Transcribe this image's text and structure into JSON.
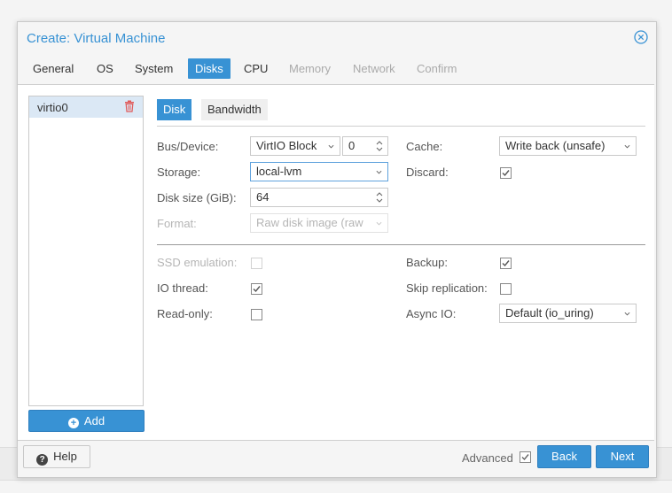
{
  "dialog": {
    "title": "Create: Virtual Machine"
  },
  "tabs": [
    {
      "label": "General",
      "state": "normal"
    },
    {
      "label": "OS",
      "state": "normal"
    },
    {
      "label": "System",
      "state": "normal"
    },
    {
      "label": "Disks",
      "state": "active"
    },
    {
      "label": "CPU",
      "state": "normal"
    },
    {
      "label": "Memory",
      "state": "disabled"
    },
    {
      "label": "Network",
      "state": "disabled"
    },
    {
      "label": "Confirm",
      "state": "disabled"
    }
  ],
  "disks": {
    "items": [
      {
        "label": "virtio0"
      }
    ],
    "add_label": "Add"
  },
  "subtabs": {
    "disk": "Disk",
    "bandwidth": "Bandwidth"
  },
  "form": {
    "bus_device": {
      "label": "Bus/Device:",
      "bus": "VirtIO Block",
      "index": "0"
    },
    "storage": {
      "label": "Storage:",
      "value": "local-lvm"
    },
    "disk_size": {
      "label": "Disk size (GiB):",
      "value": "64"
    },
    "format": {
      "label": "Format:",
      "value": "Raw disk image (raw"
    },
    "cache": {
      "label": "Cache:",
      "value": "Write back (unsafe)"
    },
    "discard": {
      "label": "Discard:",
      "checked": true
    },
    "ssd_emulation": {
      "label": "SSD emulation:",
      "checked": false,
      "disabled": true
    },
    "io_thread": {
      "label": "IO thread:",
      "checked": true
    },
    "read_only": {
      "label": "Read-only:",
      "checked": false
    },
    "backup": {
      "label": "Backup:",
      "checked": true
    },
    "skip_replication": {
      "label": "Skip replication:",
      "checked": false
    },
    "async_io": {
      "label": "Async IO:",
      "value": "Default (io_uring)"
    }
  },
  "footer": {
    "help": "Help",
    "advanced": "Advanced",
    "advanced_checked": true,
    "back": "Back",
    "next": "Next"
  },
  "colors": {
    "accent": "#3892d4",
    "delete": "#e05a5a"
  }
}
